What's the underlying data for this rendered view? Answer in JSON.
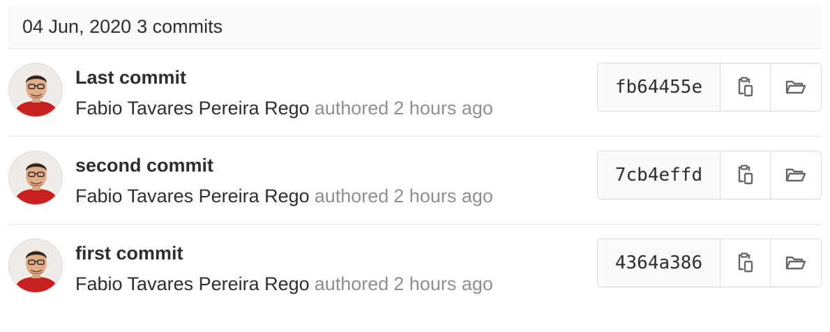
{
  "day_header": {
    "date": "04 Jun, 2020",
    "count": "3 commits"
  },
  "colors": {
    "text": "#2e2e2e",
    "muted": "#8f8f8f",
    "border": "#dbdbdb",
    "header_bg": "#fafafa",
    "icon": "#666666"
  },
  "commits": [
    {
      "title": "Last commit",
      "author": "Fabio Tavares Pereira Rego",
      "authored": "authored",
      "time": "2 hours ago",
      "sha": "fb64455e",
      "copy_icon": "clipboard-icon",
      "browse_icon": "folder-open-icon"
    },
    {
      "title": "second commit",
      "author": "Fabio Tavares Pereira Rego",
      "authored": "authored",
      "time": "2 hours ago",
      "sha": "7cb4effd",
      "copy_icon": "clipboard-icon",
      "browse_icon": "folder-open-icon"
    },
    {
      "title": "first commit",
      "author": "Fabio Tavares Pereira Rego",
      "authored": "authored",
      "time": "2 hours ago",
      "sha": "4364a386",
      "copy_icon": "clipboard-icon",
      "browse_icon": "folder-open-icon"
    }
  ]
}
